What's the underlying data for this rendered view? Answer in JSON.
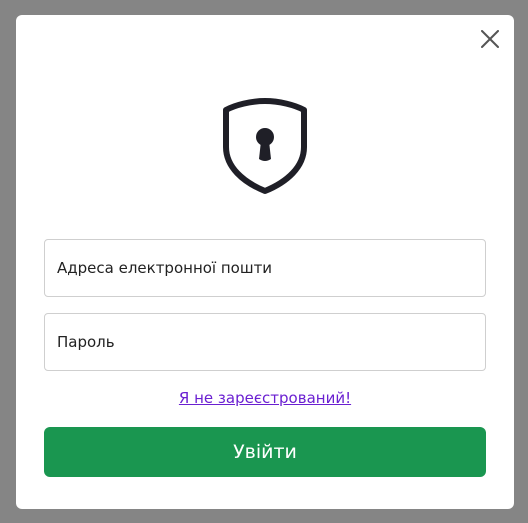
{
  "modal": {
    "close_icon": "close-icon",
    "lock_icon": "shield-keyhole-icon"
  },
  "form": {
    "email": {
      "placeholder": "Адреса електронної пошти",
      "value": ""
    },
    "password": {
      "placeholder": "Пароль",
      "value": ""
    },
    "register_link": "Я не зареєстрований!",
    "submit_label": "Увійти"
  },
  "colors": {
    "backdrop": "#858585",
    "primary": "#1a9650",
    "link": "#6a1fd1",
    "icon": "#1f1f27"
  }
}
